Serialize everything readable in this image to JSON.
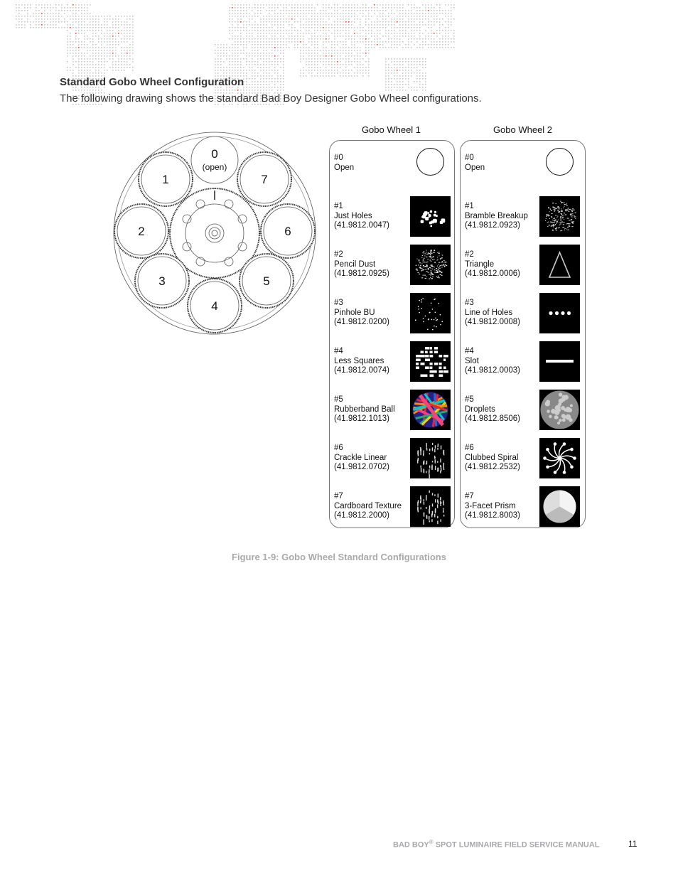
{
  "section": {
    "title": "Standard Gobo Wheel Configuration",
    "intro": "The following drawing shows the standard Bad Boy Designer Gobo Wheel configurations."
  },
  "wheel_diagram": {
    "slots": [
      {
        "num": "0",
        "note": "(open)"
      },
      {
        "num": "1"
      },
      {
        "num": "2"
      },
      {
        "num": "3"
      },
      {
        "num": "4"
      },
      {
        "num": "5"
      },
      {
        "num": "6"
      },
      {
        "num": "7"
      }
    ]
  },
  "wheels": [
    {
      "title": "Gobo Wheel 1",
      "gobos": [
        {
          "num": "#0",
          "name": "Open",
          "part": "",
          "pattern": "open"
        },
        {
          "num": "#1",
          "name": "Just Holes",
          "part": "(41.9812.0047)",
          "pattern": "holes"
        },
        {
          "num": "#2",
          "name": "Pencil Dust",
          "part": "(41.9812.0925)",
          "pattern": "dust"
        },
        {
          "num": "#3",
          "name": "Pinhole BU",
          "part": "(41.9812.0200)",
          "pattern": "pinhole"
        },
        {
          "num": "#4",
          "name": "Less Squares",
          "part": "(41.9812.0074)",
          "pattern": "squares"
        },
        {
          "num": "#5",
          "name": "Rubberband Ball",
          "part": "(41.9812.1013)",
          "pattern": "rubberband"
        },
        {
          "num": "#6",
          "name": "Crackle Linear",
          "part": "(41.9812.0702)",
          "pattern": "crackle"
        },
        {
          "num": "#7",
          "name": "Cardboard Texture",
          "part": "(41.9812.2000)",
          "pattern": "cardboard"
        }
      ]
    },
    {
      "title": "Gobo Wheel 2",
      "gobos": [
        {
          "num": "#0",
          "name": "Open",
          "part": "",
          "pattern": "open"
        },
        {
          "num": "#1",
          "name": "Bramble Breakup",
          "part": "(41.9812.0923)",
          "pattern": "bramble"
        },
        {
          "num": "#2",
          "name": "Triangle",
          "part": "(41.9812.0006)",
          "pattern": "triangle"
        },
        {
          "num": "#3",
          "name": "Line of Holes",
          "part": "(41.9812.0008)",
          "pattern": "line-holes"
        },
        {
          "num": "#4",
          "name": "Slot",
          "part": "(41.9812.0003)",
          "pattern": "slot"
        },
        {
          "num": "#5",
          "name": "Droplets",
          "part": "(41.9812.8506)",
          "pattern": "droplets"
        },
        {
          "num": "#6",
          "name": "Clubbed Spiral",
          "part": "(41.9812.2532)",
          "pattern": "spiral"
        },
        {
          "num": "#7",
          "name": "3-Facet Prism",
          "part": "(41.9812.8003)",
          "pattern": "prism"
        }
      ]
    }
  ],
  "caption": "Figure 1-9:  Gobo Wheel Standard Configurations",
  "footer": {
    "manual_title_pre": "BAD BOY",
    "registered": "®",
    "manual_title_post": " SPOT LUMINAIRE FIELD SERVICE MANUAL",
    "page_number": "11"
  },
  "colors": {
    "map_dots": "#c8c8c8",
    "map_accent": "#e8483f",
    "caption_gray": "#a7a9ac"
  }
}
